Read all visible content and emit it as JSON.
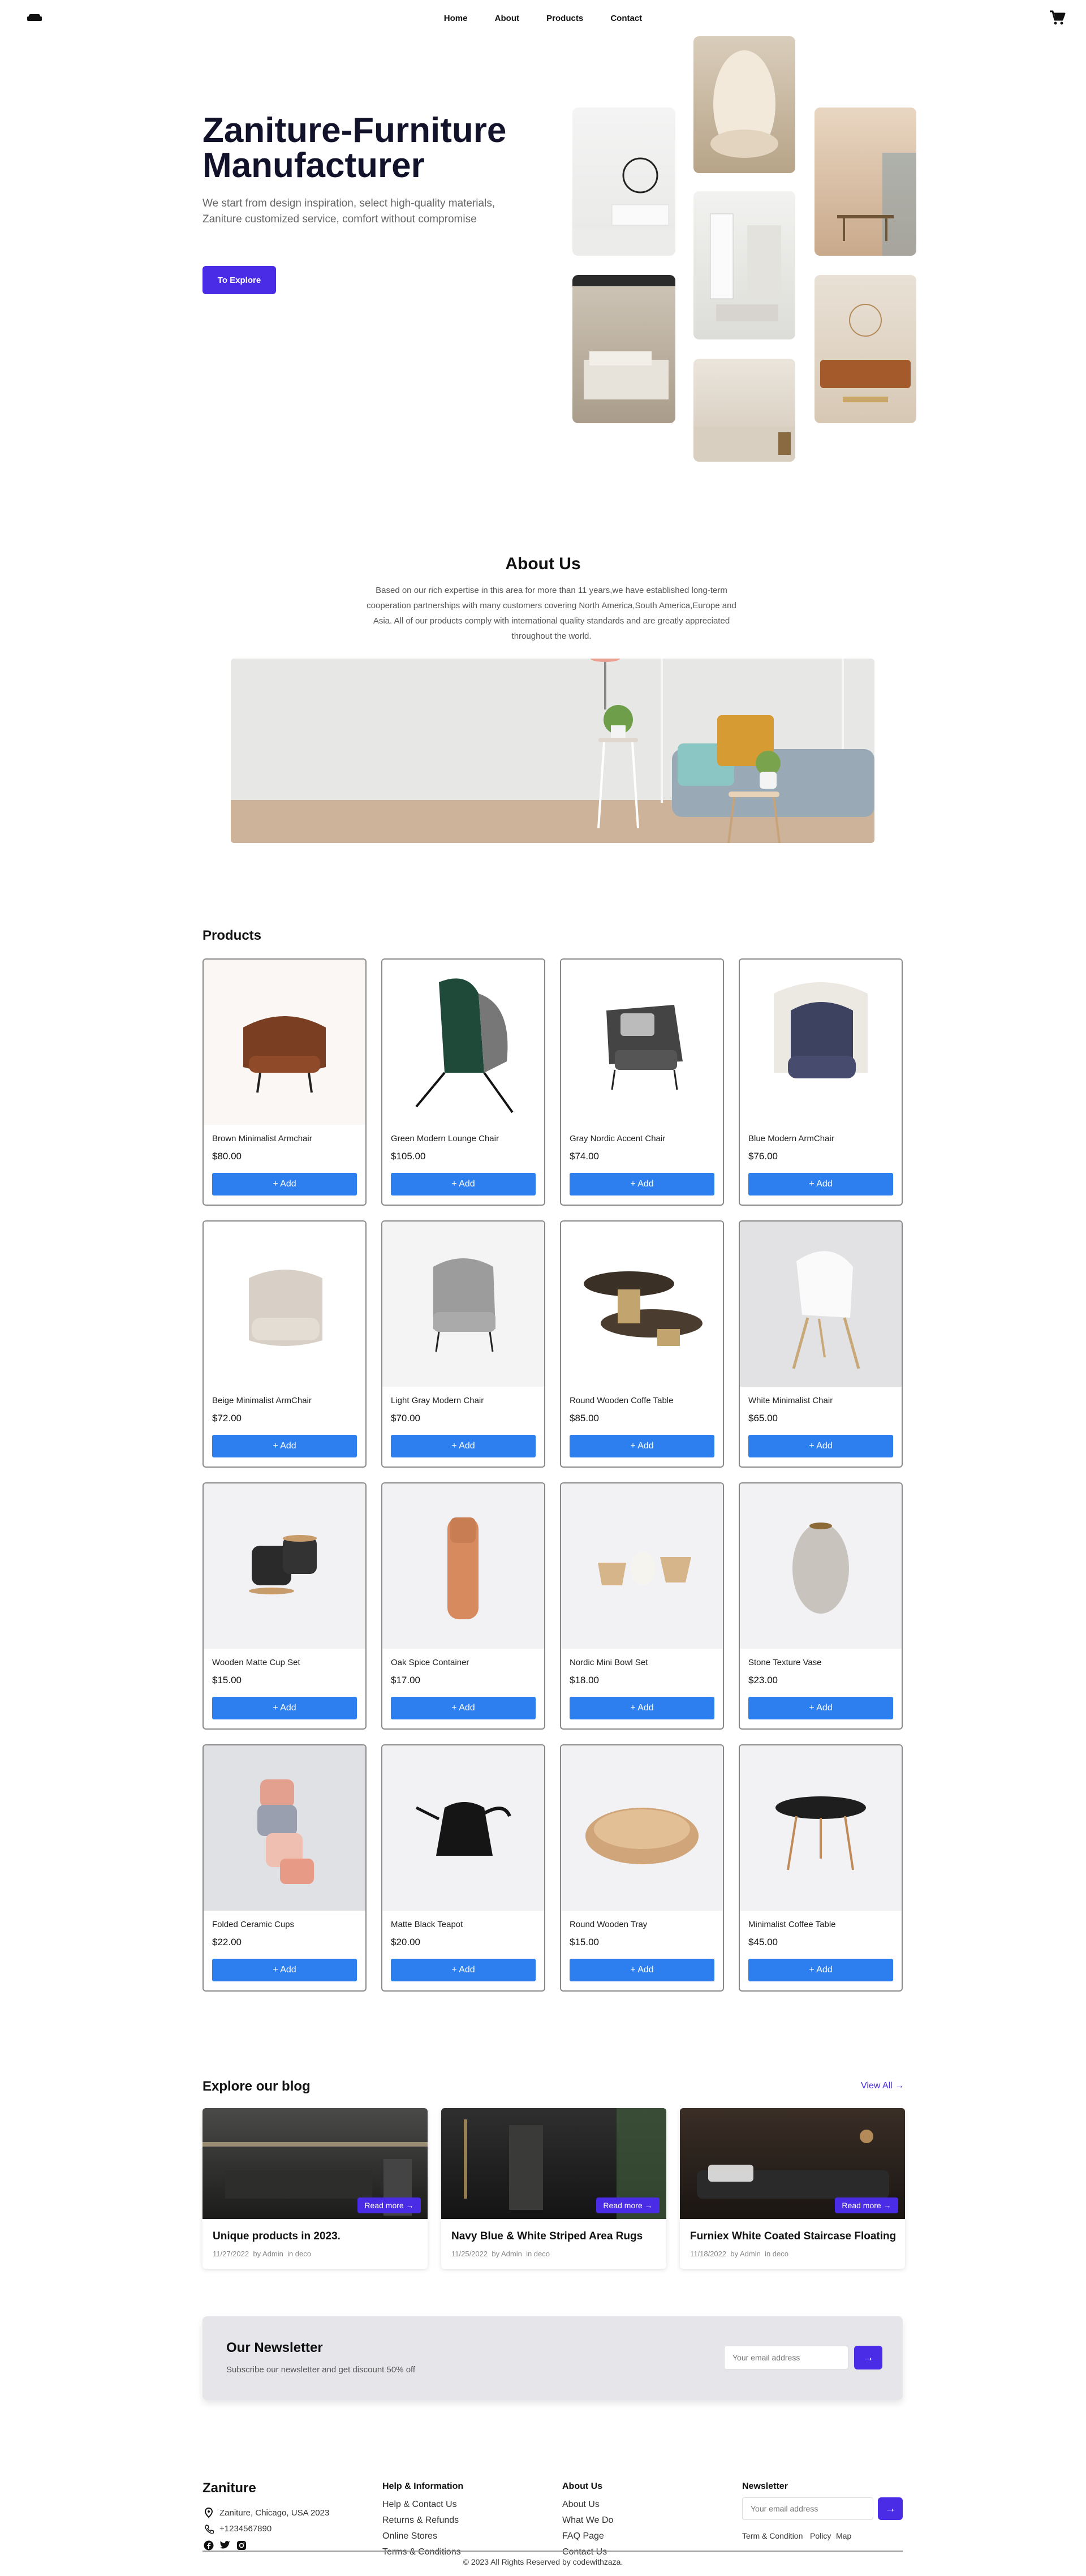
{
  "nav": {
    "links": [
      "Home",
      "About",
      "Products",
      "Contact"
    ],
    "logo_icon": "sofa-icon",
    "cart_icon": "cart-icon"
  },
  "hero": {
    "title": "Zaniture-Furniture Manufacturer",
    "subtitle": "We start from design inspiration, select high-quality materials, Zaniture customized service, comfort without compromise",
    "cta": "To Explore"
  },
  "about": {
    "title": "About Us",
    "text": "Based on our rich expertise in this area for more than 11 years,we have established long-term cooperation partnerships with many customers covering North America,South America,Europe and Asia. All of our products comply with international quality standards and are greatly appreciated throughout the world."
  },
  "products": {
    "title": "Products",
    "add_label": "+ Add",
    "items": [
      {
        "name": "Brown Minimalist Armchair",
        "price": "$80.00"
      },
      {
        "name": "Green Modern Lounge Chair",
        "price": "$105.00"
      },
      {
        "name": "Gray Nordic Accent Chair",
        "price": "$74.00"
      },
      {
        "name": "Blue Modern ArmChair",
        "price": "$76.00"
      },
      {
        "name": "Beige Minimalist ArmChair",
        "price": "$72.00"
      },
      {
        "name": "Light Gray Modern Chair",
        "price": "$70.00"
      },
      {
        "name": "Round Wooden Coffe Table",
        "price": "$85.00"
      },
      {
        "name": "White Minimalist Chair",
        "price": "$65.00"
      },
      {
        "name": "Wooden Matte Cup Set",
        "price": "$15.00"
      },
      {
        "name": "Oak Spice Container",
        "price": "$17.00"
      },
      {
        "name": "Nordic Mini Bowl Set",
        "price": "$18.00"
      },
      {
        "name": "Stone Texture Vase",
        "price": "$23.00"
      },
      {
        "name": "Folded Ceramic Cups",
        "price": "$22.00"
      },
      {
        "name": "Matte Black Teapot",
        "price": "$20.00"
      },
      {
        "name": "Round Wooden Tray",
        "price": "$15.00"
      },
      {
        "name": "Minimalist Coffee Table",
        "price": "$45.00"
      }
    ]
  },
  "blog": {
    "title": "Explore our blog",
    "view_all": "View All →",
    "read_more": "Read more →",
    "posts": [
      {
        "title": "Unique products in 2023.",
        "date": "11/27/2022",
        "author": "by Admin",
        "category": "in deco"
      },
      {
        "title": "Navy Blue & White Striped Area Rugs",
        "date": "11/25/2022",
        "author": "by Admin",
        "category": "in deco"
      },
      {
        "title": "Furniex White Coated Staircase Floating",
        "date": "11/18/2022",
        "author": "by Admin",
        "category": "in deco"
      }
    ]
  },
  "newsletter": {
    "title": "Our Newsletter",
    "subtitle": "Subscribe our newsletter and get discount 50% off",
    "placeholder": "Your email address",
    "button": "→"
  },
  "footer": {
    "brand": "Zaniture",
    "address": "Zaniture, Chicago, USA 2023",
    "phone": "+1234567890",
    "help_title": "Help & Information",
    "help_links": [
      "Help & Contact Us",
      "Returns & Refunds",
      "Online Stores",
      "Terms & Conditions"
    ],
    "about_title": "About Us",
    "about_links": [
      "About Us",
      "What We Do",
      "FAQ Page",
      "Contact Us"
    ],
    "newsletter_title": "Newsletter",
    "newsletter_placeholder": "Your email address",
    "newsletter_button": "→",
    "legal_links": [
      "Term & Condition",
      "Policy",
      "Map"
    ],
    "copyright": "© 2023 All Rights Reserved by codewithzaza."
  },
  "colors": {
    "accent": "#4a2ce6",
    "add_button": "#2d7ff0",
    "newsletter_bg": "#e5e5ea"
  }
}
